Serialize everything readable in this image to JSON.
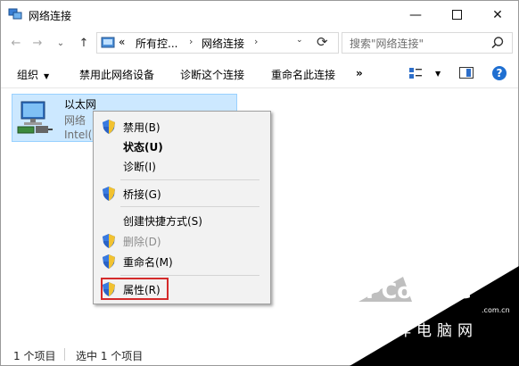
{
  "window": {
    "title": "网络连接",
    "controls": {
      "minimize": "—",
      "close": "✕"
    }
  },
  "nav": {
    "back": "←",
    "forward": "→",
    "dropdown": "⌄",
    "up": "↑"
  },
  "address": {
    "prefix": "«",
    "crumbs": [
      "所有控...",
      "网络连接"
    ],
    "separator": "›",
    "refresh": "⟳"
  },
  "search": {
    "placeholder": "搜索\"网络连接\""
  },
  "toolbar": {
    "organize": "组织",
    "disable_device": "禁用此网络设备",
    "diagnose": "诊断这个连接",
    "rename": "重命名此连接",
    "more": "»"
  },
  "item": {
    "name": "以太网",
    "status": "网络",
    "adapter": "Intel(R)"
  },
  "context_menu": {
    "items": [
      {
        "label": "禁用(B)",
        "icon": "uac-shield-icon"
      },
      {
        "label": "状态(U)",
        "bold": true
      },
      {
        "label": "诊断(I)"
      },
      {
        "label": "桥接(G)",
        "icon": "uac-shield-icon"
      },
      {
        "label": "创建快捷方式(S)"
      },
      {
        "label": "删除(D)",
        "icon": "uac-shield-icon",
        "disabled": true
      },
      {
        "label": "重命名(M)",
        "icon": "uac-shield-icon"
      },
      {
        "label": "属性(R)",
        "icon": "uac-shield-icon",
        "highlighted": true
      }
    ],
    "highlight_color": "#d42a2a"
  },
  "statusbar": {
    "count": "1 个项目",
    "selected": "选中 1 个项目"
  },
  "watermark": {
    "brand": "PConline",
    "domain": ".com.cn",
    "chinese": "太平洋电脑网"
  },
  "colors": {
    "selection": "#cce8ff",
    "selection_border": "#99d1ff",
    "help_blue": "#1f6fd1"
  }
}
